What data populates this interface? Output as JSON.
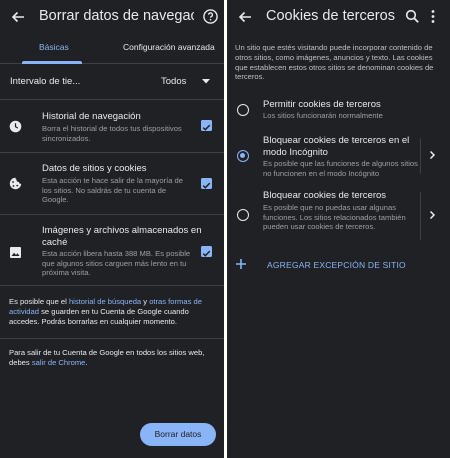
{
  "left": {
    "title": "Borrar datos de navegación",
    "tabs": {
      "basic": "Básicas",
      "advanced": "Configuración avanzada"
    },
    "range": {
      "label": "Intervalo de tie...",
      "value": "Todos"
    },
    "items": [
      {
        "title": "Historial de navegación",
        "desc": "Borra el historial de todos tus dispositivos sincronizados.",
        "checked": true
      },
      {
        "title": "Datos de sitios y cookies",
        "desc": "Esta acción te hace salir de la mayoría de los sitios. No saldrás de tu cuenta de Google.",
        "checked": true
      },
      {
        "title": "Imágenes y archivos almacenados en caché",
        "desc": "Esta acción libera hasta 388 MB. Es posible que algunos sitios carguen más lento en tu próxima visita.",
        "checked": true
      }
    ],
    "note1": {
      "pre": "Es posible que el ",
      "link1": "historial de búsqueda",
      "mid": " y ",
      "link2": "otras formas de actividad",
      "post": " se guarden en tu Cuenta de Google cuando accedes. Podrás borrarlas en cualquier momento."
    },
    "note2": {
      "pre": "Para salir de tu Cuenta de Google en todos los sitios web, debes ",
      "link": "salir de Chrome",
      "post": "."
    },
    "button": "Borrar datos"
  },
  "right": {
    "title": "Cookies de terceros",
    "intro": "Un sitio que estés visitando puede incorporar contenido de otros sitios, como imágenes, anuncios y texto. Las cookies que establecen estos otros sitios se denominan cookies de terceros.",
    "options": [
      {
        "title": "Permitir cookies de terceros",
        "desc": "Los sitios funcionarán normalmente",
        "selected": false
      },
      {
        "title": "Bloquear cookies de terceros en el modo Incógnito",
        "desc": "Es posible que las funciones de algunos sitios no funcionen en el modo Incógnito",
        "selected": true
      },
      {
        "title": "Bloquear cookies de terceros",
        "desc": "Es posible que no puedas usar algunas funciones. Los sitios relacionados también pueden usar cookies de terceros.",
        "selected": false
      }
    ],
    "add_exception": "AGREGAR EXCEPCIÓN DE SITIO"
  },
  "icons": {
    "back": "arrow-back-icon",
    "help": "help-circle-icon",
    "search": "search-icon",
    "more": "more-vert-icon",
    "history": "clock-icon",
    "cookie": "cookie-icon",
    "image": "image-icon",
    "caret": "caret-down-icon",
    "chevron": "chevron-right-icon",
    "add": "plus-icon"
  },
  "colors": {
    "background": "#202124",
    "accent": "#8ab4f8",
    "text": "#e8eaed",
    "secondary": "#9aa0a6"
  }
}
